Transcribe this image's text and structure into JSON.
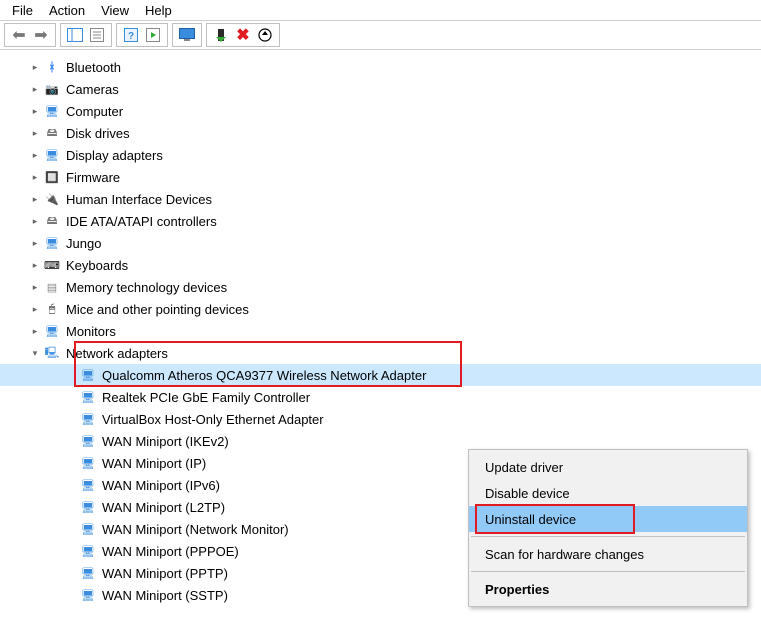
{
  "menubar": {
    "file": "File",
    "action": "Action",
    "view": "View",
    "help": "Help"
  },
  "toolbar": {
    "back": "←",
    "forward": "→",
    "icons": [
      "show-hide-tree",
      "properties",
      "help-icon",
      "play-icon",
      "monitor-icon",
      "scan-icon",
      "delete-icon",
      "update-icon"
    ]
  },
  "tree": {
    "categories": [
      {
        "id": "bluetooth",
        "label": "Bluetooth",
        "iconClass": "ic-bluetooth",
        "iconText": "ᚼ"
      },
      {
        "id": "cameras",
        "label": "Cameras",
        "iconClass": "ic-camera"
      },
      {
        "id": "computer",
        "label": "Computer",
        "iconClass": "ic-computer"
      },
      {
        "id": "disk",
        "label": "Disk drives",
        "iconClass": "ic-disk"
      },
      {
        "id": "display",
        "label": "Display adapters",
        "iconClass": "ic-display"
      },
      {
        "id": "firmware",
        "label": "Firmware",
        "iconClass": "ic-firmware"
      },
      {
        "id": "hid",
        "label": "Human Interface Devices",
        "iconClass": "ic-hid"
      },
      {
        "id": "ide",
        "label": "IDE ATA/ATAPI controllers",
        "iconClass": "ic-ide"
      },
      {
        "id": "jungo",
        "label": "Jungo",
        "iconClass": "ic-jungo"
      },
      {
        "id": "keyboards",
        "label": "Keyboards",
        "iconClass": "ic-keyboard"
      },
      {
        "id": "memory",
        "label": "Memory technology devices",
        "iconClass": "ic-memory"
      },
      {
        "id": "mice",
        "label": "Mice and other pointing devices",
        "iconClass": "ic-mouse"
      },
      {
        "id": "monitors",
        "label": "Monitors",
        "iconClass": "ic-monitors"
      }
    ],
    "expanded": {
      "label": "Network adapters",
      "iconClass": "ic-netadapter",
      "children": [
        {
          "label": "Qualcomm Atheros QCA9377 Wireless Network Adapter",
          "selected": true
        },
        {
          "label": "Realtek PCIe GbE Family Controller"
        },
        {
          "label": "VirtualBox Host-Only Ethernet Adapter"
        },
        {
          "label": "WAN Miniport (IKEv2)"
        },
        {
          "label": "WAN Miniport (IP)"
        },
        {
          "label": "WAN Miniport (IPv6)"
        },
        {
          "label": "WAN Miniport (L2TP)"
        },
        {
          "label": "WAN Miniport (Network Monitor)"
        },
        {
          "label": "WAN Miniport (PPPOE)"
        },
        {
          "label": "WAN Miniport (PPTP)"
        },
        {
          "label": "WAN Miniport (SSTP)"
        }
      ]
    }
  },
  "context_menu": {
    "items": [
      {
        "label": "Update driver"
      },
      {
        "label": "Disable device"
      },
      {
        "label": "Uninstall device",
        "highlight": true,
        "redbox": true
      },
      {
        "sep": true
      },
      {
        "label": "Scan for hardware changes"
      },
      {
        "sep": true
      },
      {
        "label": "Properties",
        "bold": true
      }
    ]
  }
}
